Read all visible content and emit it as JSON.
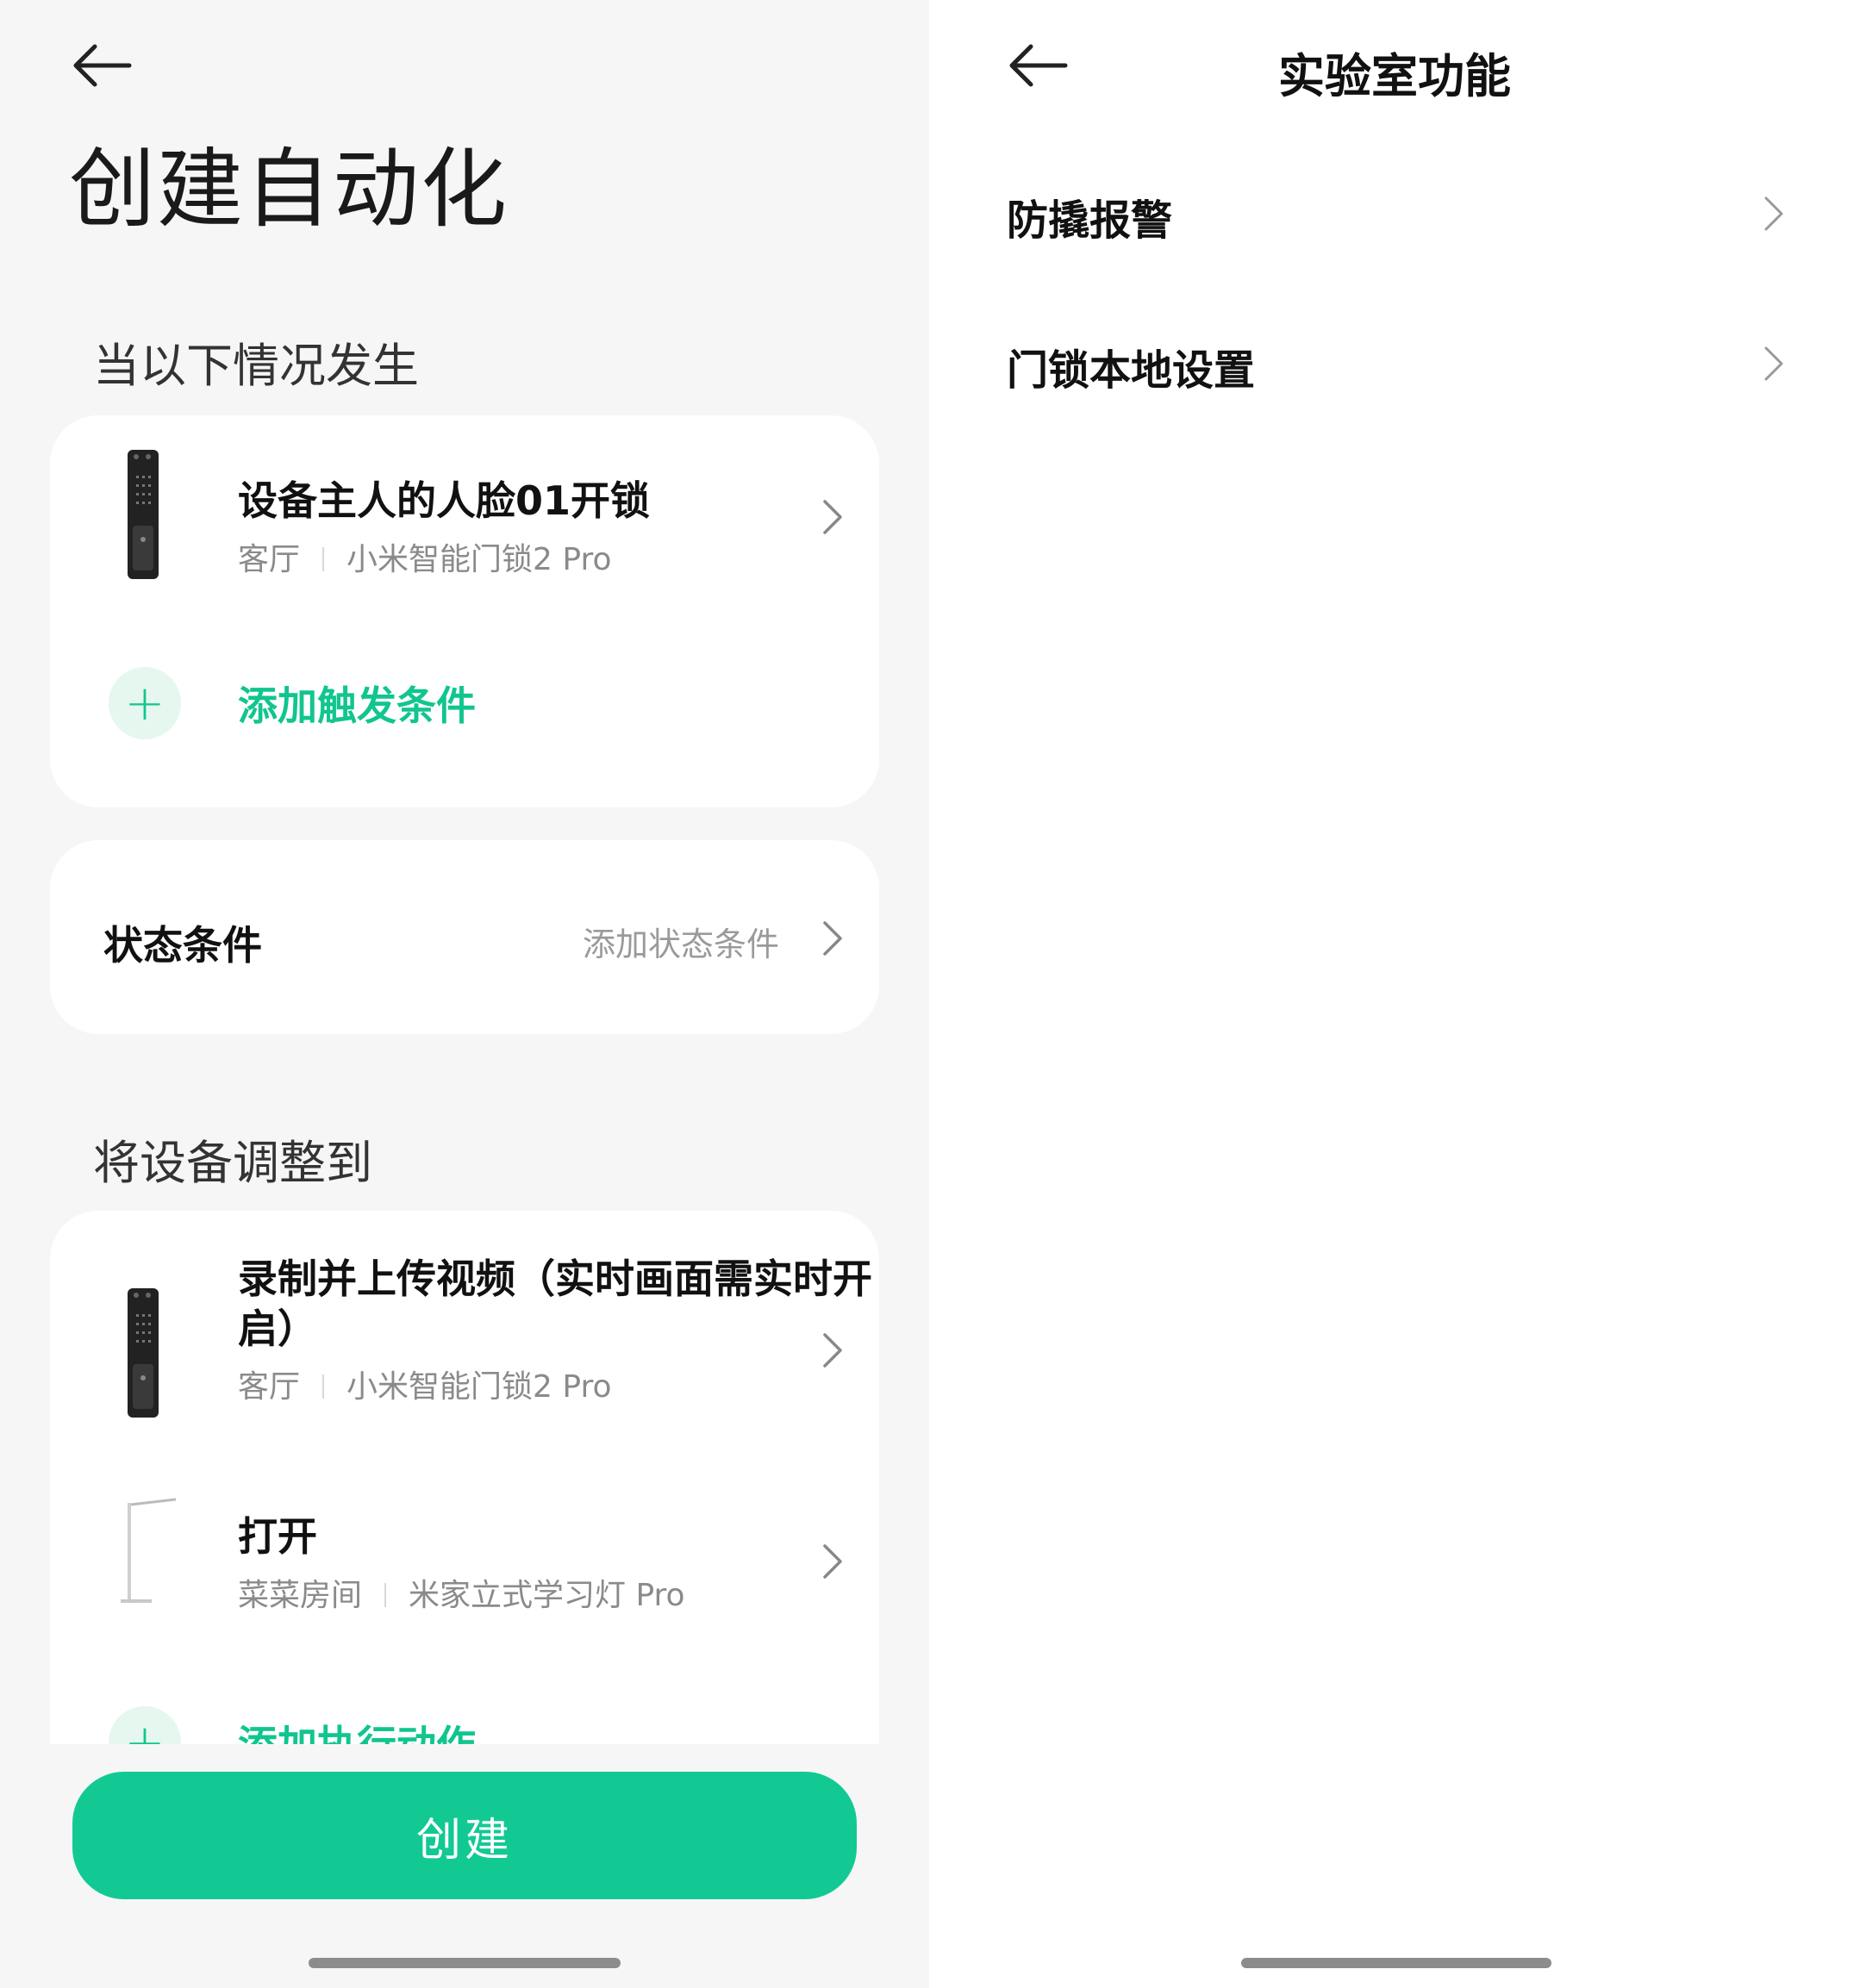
{
  "left": {
    "title": "创建自动化",
    "when_section": "当以下情况发生",
    "trigger": {
      "title": "设备主人的人脸01开锁",
      "room": "客厅",
      "device": "小米智能门锁2 Pro",
      "icon": "door-lock-image"
    },
    "add_trigger_label": "添加触发条件",
    "state_condition": {
      "label": "状态条件",
      "action": "添加状态条件"
    },
    "action_section": "将设备调整到",
    "actions": [
      {
        "title": "录制并上传视频（实时画面需实时开启）",
        "room": "客厅",
        "device": "小米智能门锁2 Pro",
        "icon": "door-lock-image"
      },
      {
        "title": "打开",
        "room": "菜菜房间",
        "device": "米家立式学习灯 Pro",
        "icon": "floor-lamp-image"
      }
    ],
    "add_action_label": "添加执行动作",
    "create_button": "创建"
  },
  "right": {
    "title": "实验室功能",
    "items": [
      "防撬报警",
      "门锁本地设置"
    ]
  },
  "colors": {
    "accent": "#12c994",
    "accent_light": "#e5f7ef",
    "background": "#f6f6f6"
  }
}
